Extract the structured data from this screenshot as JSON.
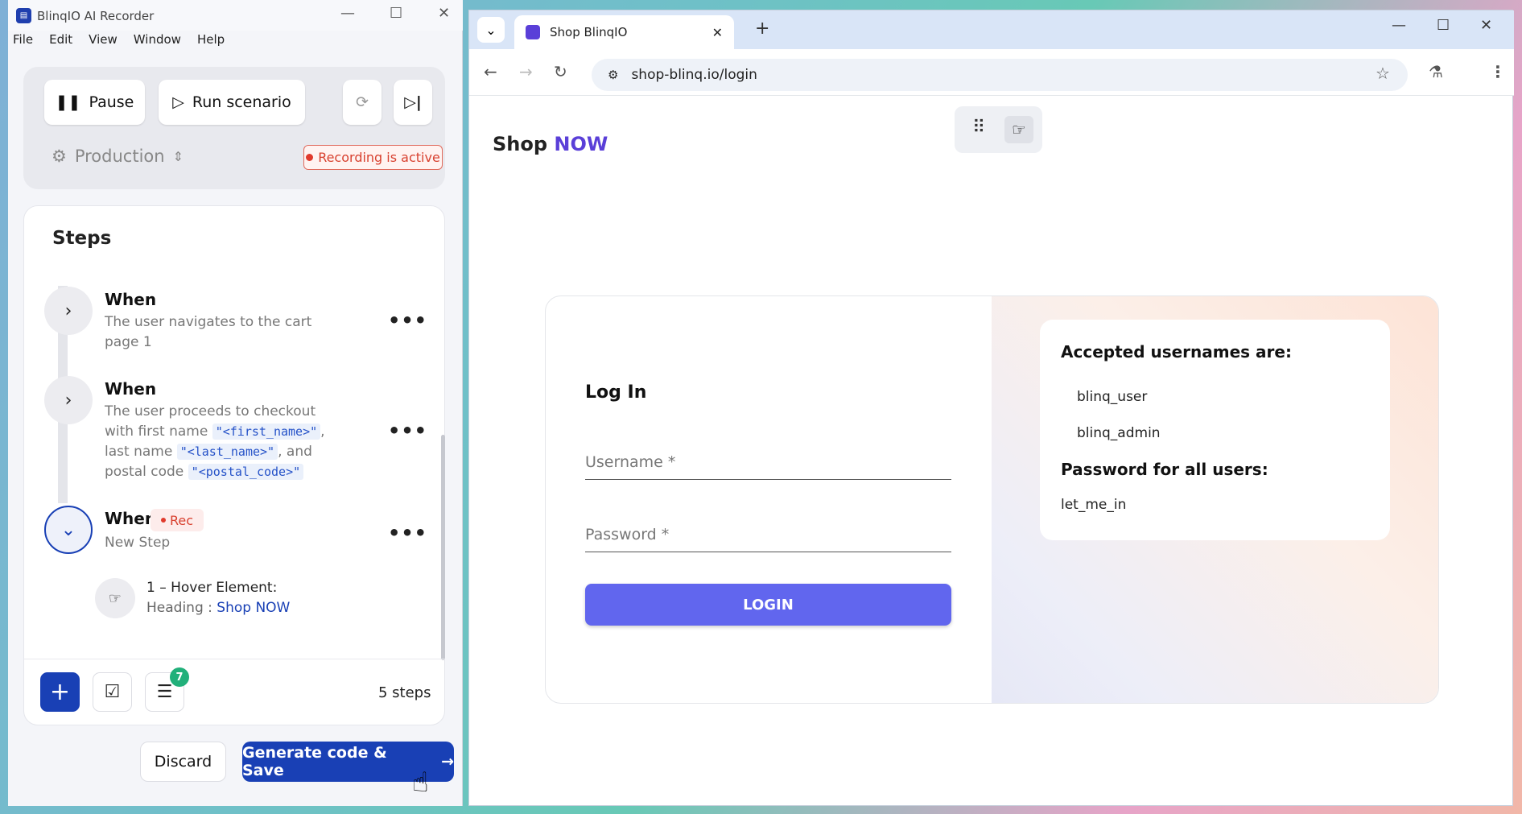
{
  "recorder": {
    "title": "BlinqIO AI Recorder",
    "menu": [
      "File",
      "Edit",
      "View",
      "Window",
      "Help"
    ],
    "pause_label": "Pause",
    "run_label": "Run scenario",
    "environment": "Production",
    "recording_status": "Recording is active",
    "steps_title": "Steps",
    "steps": [
      {
        "keyword": "When",
        "text": "The user navigates to the cart page 1"
      },
      {
        "keyword": "When",
        "text_parts": [
          "The user proceeds to checkout with first name ",
          "\"<first_name>\"",
          ", last name ",
          "\"<last_name>\"",
          ", and postal code ",
          "\"<postal_code>\""
        ]
      },
      {
        "keyword": "When",
        "rec_label": "Rec",
        "text": "New Step"
      }
    ],
    "action": {
      "title": "1 – Hover Element:",
      "prefix": "Heading : ",
      "target": "Shop NOW"
    },
    "badge_count": "7",
    "step_count": "5 steps",
    "discard_label": "Discard",
    "generate_label": "Generate code & Save"
  },
  "browser": {
    "tab_title": "Shop BlinqIO",
    "url": "shop-blinq.io/login",
    "logo_main": "Shop",
    "logo_accent": "NOW",
    "login_title": "Log In",
    "username_placeholder": "Username *",
    "password_placeholder": "Password *",
    "login_button": "LOGIN",
    "info_usernames_title": "Accepted usernames are:",
    "usernames": [
      "blinq_user",
      "blinq_admin"
    ],
    "info_password_title": "Password for all users:",
    "password": "let_me_in"
  },
  "colors": {
    "primary": "#1940b5",
    "accent": "#5a3fd8",
    "login": "#6166ee",
    "rec": "#d8412f"
  }
}
